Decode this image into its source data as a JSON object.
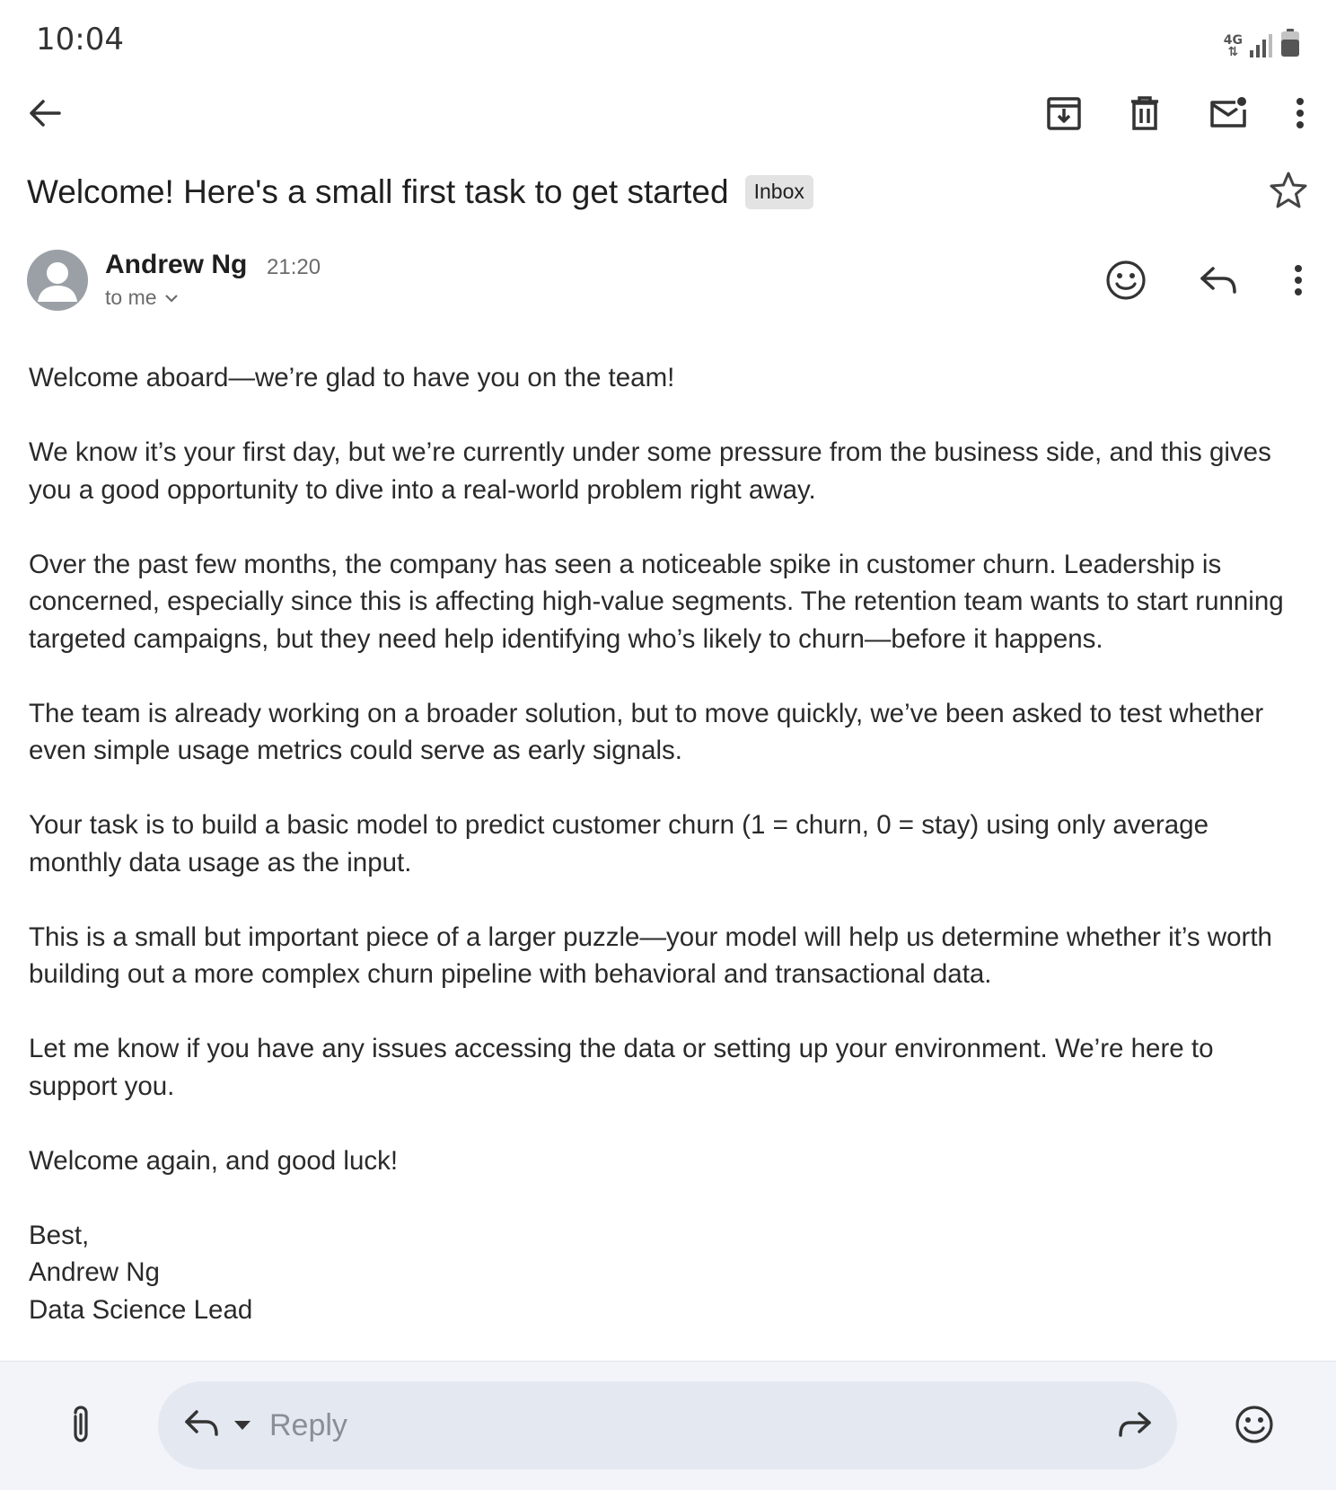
{
  "status_bar": {
    "time": "10:04",
    "network": "4G"
  },
  "toolbar": {
    "icons": [
      "back-arrow-icon",
      "archive-icon",
      "trash-icon",
      "mark-unread-icon",
      "more-vert-icon"
    ]
  },
  "email": {
    "subject": "Welcome! Here's a small first task to get started",
    "label": "Inbox",
    "sender": {
      "name": "Andrew Ng",
      "time": "21:20",
      "recipient": "to me"
    },
    "body": [
      "Welcome aboard—we’re glad to have you on the team!",
      "We know it’s your first day, but we’re currently under some pressure from the business side, and this gives you a good opportunity to dive into a real-world problem right away.",
      "Over the past few months, the company has seen a noticeable spike in customer churn. Leadership is concerned, especially since this is affecting high-value segments. The retention team wants to start running targeted campaigns, but they need help identifying who’s likely to churn—before it happens.",
      "The team is already working on a broader solution, but to move quickly, we’ve been asked to test whether even simple usage metrics could serve as early signals.",
      "Your task is to build a basic model to predict customer churn (1 = churn, 0 = stay) using only average monthly data usage as the input.",
      "This is a small but important piece of a larger puzzle—your model will help us determine whether it’s worth building out a more complex churn pipeline with behavioral and transactional data.",
      "Let me know if you have any issues accessing the data or setting up your environment. We’re here to support you.",
      "Welcome again, and good luck!"
    ],
    "signature": [
      "Best,",
      "Andrew Ng",
      "Data Science Lead"
    ]
  },
  "reply_bar": {
    "placeholder": "Reply"
  },
  "colors": {
    "bottom_bar": "#f2f4f9",
    "reply_pill": "#e4e8f1",
    "label_chip": "#e3e3e3",
    "avatar": "#9aa0a6"
  }
}
